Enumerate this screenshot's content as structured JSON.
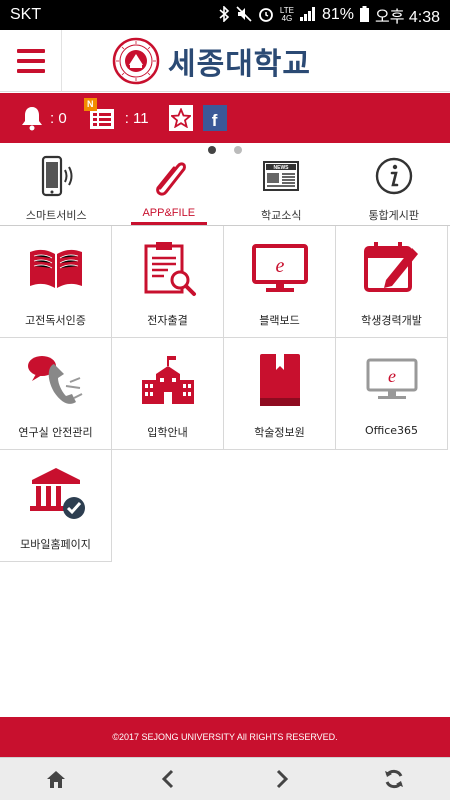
{
  "status_bar": {
    "carrier": "SKT",
    "network": "LTE",
    "network_sub": "4G",
    "battery": "81%",
    "time": "오후 4:38"
  },
  "header": {
    "logo_text": "세종대학교",
    "brand_color": "#c8102e",
    "logo_text_color": "#2b4a74"
  },
  "notifications": {
    "alerts_count": ": 0",
    "news_badge": "N",
    "news_count": ": 11",
    "facebook_letter": "f"
  },
  "tabs": [
    {
      "label": "스마트서비스",
      "icon": "smartphone-icon",
      "active": false
    },
    {
      "label": "APP&FILE",
      "icon": "paperclip-icon",
      "active": true
    },
    {
      "label": "학교소식",
      "icon": "newspaper-icon",
      "active": false
    },
    {
      "label": "통합게시판",
      "icon": "info-icon",
      "active": false
    }
  ],
  "apps": [
    {
      "label": "고전독서인증",
      "icon": "book-icon"
    },
    {
      "label": "전자출결",
      "icon": "attendance-icon"
    },
    {
      "label": "블랙보드",
      "icon": "blackboard-icon"
    },
    {
      "label": "학생경력개발",
      "icon": "calendar-edit-icon"
    },
    {
      "label": "연구실 안전관리",
      "icon": "phone-call-icon"
    },
    {
      "label": "입학안내",
      "icon": "school-icon"
    },
    {
      "label": "학술정보원",
      "icon": "library-book-icon"
    },
    {
      "label": "Office365",
      "icon": "monitor-icon"
    },
    {
      "label": "모바일홈페이지",
      "icon": "bank-check-icon"
    }
  ],
  "footer": {
    "copyright": "©2017 SEJONG UNIVERSITY All RIGHTS RESERVED."
  },
  "bottom_nav": [
    {
      "name": "home-icon"
    },
    {
      "name": "back-icon"
    },
    {
      "name": "forward-icon"
    },
    {
      "name": "refresh-icon"
    }
  ]
}
